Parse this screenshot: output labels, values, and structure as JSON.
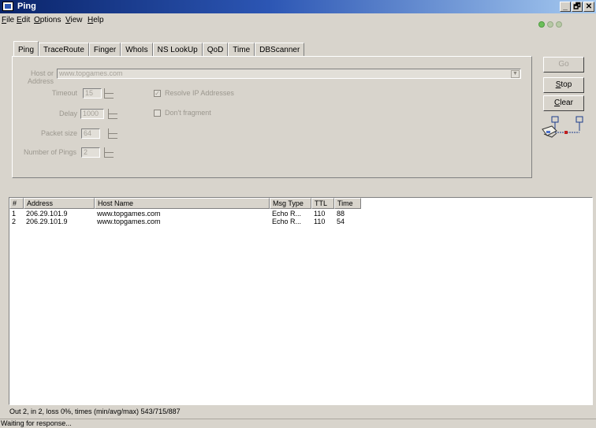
{
  "window": {
    "title": "Ping",
    "buttons": [
      "_",
      "🗗",
      "✕"
    ]
  },
  "menu": [
    "File",
    "Edit",
    "Options",
    "View",
    "Help"
  ],
  "tabs": [
    "Ping",
    "TraceRoute",
    "Finger",
    "WhoIs",
    "NS LookUp",
    "QoD",
    "Time",
    "DBScanner"
  ],
  "form": {
    "host_label": "Host or Address",
    "host_value": "www.topgames.com",
    "timeout_label": "Timeout",
    "timeout_value": "15",
    "delay_label": "Delay",
    "delay_value": "1000",
    "packet_label": "Packet size",
    "packet_value": "64",
    "pings_label": "Number of Pings",
    "pings_value": "2",
    "resolve_label": "Resolve IP Addresses",
    "resolve_checked": true,
    "dont_fragment_label": "Don't fragment",
    "dont_fragment_checked": false
  },
  "buttons": {
    "go": "Go",
    "stop": "Stop",
    "clear": "Clear"
  },
  "grid": {
    "columns": [
      "#",
      "Address",
      "Host Name",
      "Msg Type",
      "TTL",
      "Time"
    ],
    "rows": [
      [
        "1",
        "206.29.101.9",
        "www.topgames.com",
        "Echo R...",
        "110",
        "88"
      ],
      [
        "2",
        "206.29.101.9",
        "www.topgames.com",
        "Echo R...",
        "110",
        "54"
      ]
    ]
  },
  "status": {
    "summary": "Out 2, in 2, loss 0%, times (min/avg/max) 543/715/887",
    "message": "Waiting for response..."
  },
  "colors": {
    "titlebar_start": "#0a246a",
    "titlebar_end": "#a6caf0",
    "status_light": "#6cbf5a"
  }
}
